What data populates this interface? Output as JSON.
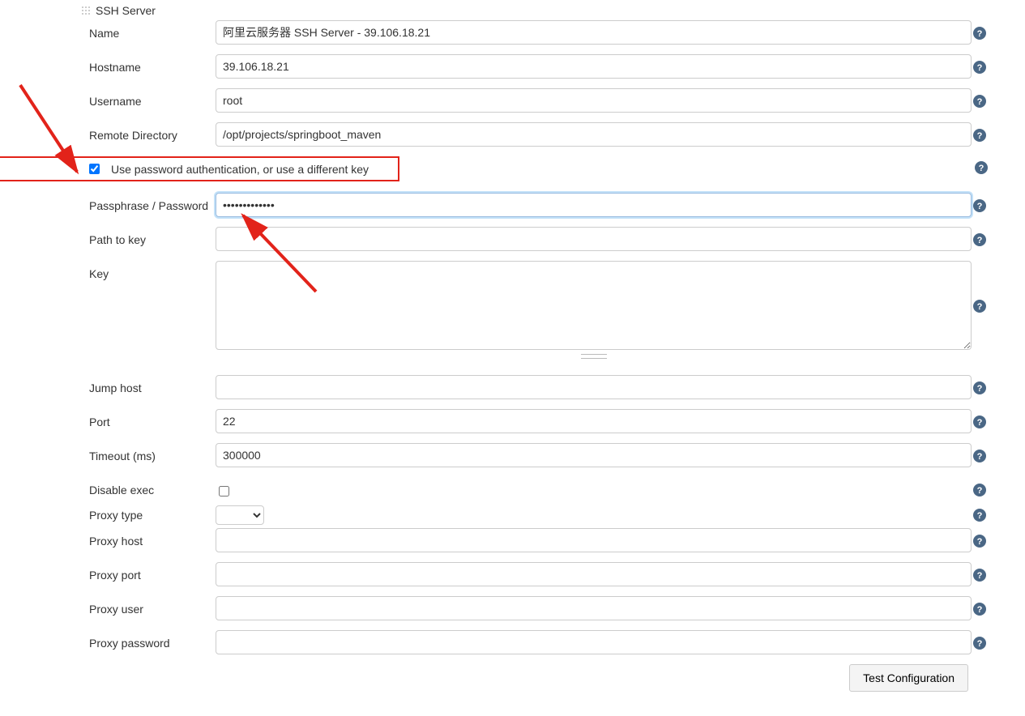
{
  "section_title": "SSH Server",
  "labels": {
    "name": "Name",
    "hostname": "Hostname",
    "username": "Username",
    "remote_dir": "Remote Directory",
    "use_pw": "Use password authentication, or use a different key",
    "passphrase": "Passphrase / Password",
    "path_key": "Path to key",
    "key": "Key",
    "jump_host": "Jump host",
    "port": "Port",
    "timeout": "Timeout (ms)",
    "disable_exec": "Disable exec",
    "proxy_type": "Proxy type",
    "proxy_host": "Proxy host",
    "proxy_port": "Proxy port",
    "proxy_user": "Proxy user",
    "proxy_password": "Proxy password"
  },
  "values": {
    "name": "阿里云服务器 SSH Server - 39.106.18.21",
    "hostname": "39.106.18.21",
    "username": "root",
    "remote_dir": "/opt/projects/springboot_maven",
    "use_pw_checked": true,
    "passphrase": "•••••••••••••",
    "path_key": "",
    "key": "",
    "jump_host": "",
    "port": "22",
    "timeout": "300000",
    "disable_exec_checked": false,
    "proxy_type": "",
    "proxy_host": "",
    "proxy_port": "",
    "proxy_user": "",
    "proxy_password": ""
  },
  "buttons": {
    "test_config": "Test Configuration"
  }
}
